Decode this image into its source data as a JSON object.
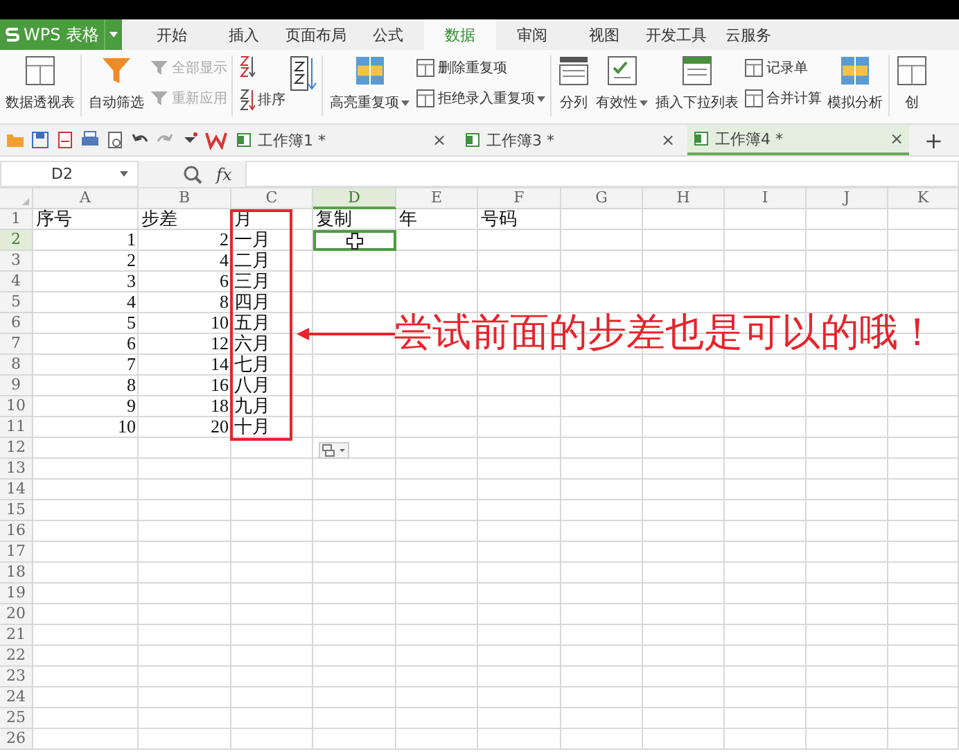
{
  "app": {
    "logo": "WPS 表格"
  },
  "menu_tabs": [
    {
      "label": "开始",
      "selected": false
    },
    {
      "label": "插入",
      "selected": false
    },
    {
      "label": "页面布局",
      "selected": false
    },
    {
      "label": "公式",
      "selected": false
    },
    {
      "label": "数据",
      "selected": true
    },
    {
      "label": "审阅",
      "selected": false
    },
    {
      "label": "视图",
      "selected": false
    },
    {
      "label": "开发工具",
      "selected": false
    },
    {
      "label": "云服务",
      "selected": false
    }
  ],
  "ribbon": {
    "groups": [
      {
        "items": [
          {
            "kind": "large",
            "label": "数据透视表",
            "disabled": false,
            "dropdown": false
          }
        ]
      },
      {
        "items": [
          {
            "kind": "large",
            "label": "自动筛选",
            "disabled": false,
            "dropdown": false
          },
          {
            "kind": "stack",
            "items": [
              {
                "label": "全部显示",
                "disabled": true,
                "dropdown": false
              },
              {
                "label": "重新应用",
                "disabled": true,
                "dropdown": false
              }
            ]
          }
        ]
      },
      {
        "items": [
          {
            "kind": "sort",
            "label": "排序",
            "disabled": false,
            "dropdown": false
          }
        ]
      },
      {
        "items": [
          {
            "kind": "large",
            "label": "高亮重复项",
            "disabled": false,
            "dropdown": true
          },
          {
            "kind": "stack",
            "items": [
              {
                "label": "删除重复项",
                "disabled": false,
                "dropdown": false
              },
              {
                "label": "拒绝录入重复项",
                "disabled": false,
                "dropdown": true
              }
            ]
          }
        ]
      },
      {
        "items": [
          {
            "kind": "large",
            "label": "分列",
            "disabled": false,
            "dropdown": false
          },
          {
            "kind": "large",
            "label": "有效性",
            "disabled": false,
            "dropdown": true
          },
          {
            "kind": "large",
            "label": "插入下拉列表",
            "disabled": false,
            "dropdown": false
          },
          {
            "kind": "stack",
            "items": [
              {
                "label": "记录单",
                "disabled": false,
                "dropdown": false
              },
              {
                "label": "合并计算",
                "disabled": false,
                "dropdown": false
              }
            ]
          },
          {
            "kind": "large",
            "label": "模拟分析",
            "disabled": false,
            "dropdown": false
          }
        ]
      },
      {
        "items": [
          {
            "kind": "large",
            "label": "创",
            "disabled": false,
            "dropdown": false
          }
        ]
      }
    ]
  },
  "doc_tabs": [
    {
      "label": "工作簿1 *",
      "close": "×",
      "selected": false
    },
    {
      "label": "工作簿3 *",
      "close": "×",
      "selected": false
    },
    {
      "label": "工作簿4 *",
      "close": "×",
      "selected": true
    }
  ],
  "new_tab": "+",
  "formula_bar": {
    "name_box": "D2",
    "fx": "fx"
  },
  "sheet": {
    "columns": [
      "A",
      "B",
      "C",
      "D",
      "E",
      "F",
      "G",
      "H",
      "I",
      "J",
      "K"
    ],
    "rows": [
      {
        "number": "1",
        "cells": [
          {
            "text": "序号",
            "kind": "text",
            "selected": false
          },
          {
            "text": "步差",
            "kind": "text",
            "selected": false
          },
          {
            "text": "月",
            "kind": "text",
            "selected": false
          },
          {
            "text": "复制",
            "kind": "text",
            "selected": false
          },
          {
            "text": "年",
            "kind": "text",
            "selected": false
          },
          {
            "text": "号码",
            "kind": "text",
            "selected": false
          }
        ]
      },
      {
        "number": "2",
        "cells": [
          {
            "text": "1",
            "kind": "number",
            "selected": false
          },
          {
            "text": "2",
            "kind": "number",
            "selected": false
          },
          {
            "text": "一月",
            "kind": "text",
            "selected": false
          },
          {
            "kind": "text",
            "selected": true
          }
        ]
      },
      {
        "number": "3",
        "cells": [
          {
            "text": "2",
            "kind": "number",
            "selected": false
          },
          {
            "text": "4",
            "kind": "number",
            "selected": false
          },
          {
            "text": "二月",
            "kind": "text",
            "selected": false
          }
        ]
      },
      {
        "number": "4",
        "cells": [
          {
            "text": "3",
            "kind": "number",
            "selected": false
          },
          {
            "text": "6",
            "kind": "number",
            "selected": false
          },
          {
            "text": "三月",
            "kind": "text",
            "selected": false
          }
        ]
      },
      {
        "number": "5",
        "cells": [
          {
            "text": "4",
            "kind": "number",
            "selected": false
          },
          {
            "text": "8",
            "kind": "number",
            "selected": false
          },
          {
            "text": "四月",
            "kind": "text",
            "selected": false
          }
        ]
      },
      {
        "number": "6",
        "cells": [
          {
            "text": "5",
            "kind": "number",
            "selected": false
          },
          {
            "text": "10",
            "kind": "number",
            "selected": false
          },
          {
            "text": "五月",
            "kind": "text",
            "selected": false
          }
        ]
      },
      {
        "number": "7",
        "cells": [
          {
            "text": "6",
            "kind": "number",
            "selected": false
          },
          {
            "text": "12",
            "kind": "number",
            "selected": false
          },
          {
            "text": "六月",
            "kind": "text",
            "selected": false
          }
        ]
      },
      {
        "number": "8",
        "cells": [
          {
            "text": "7",
            "kind": "number",
            "selected": false
          },
          {
            "text": "14",
            "kind": "number",
            "selected": false
          },
          {
            "text": "七月",
            "kind": "text",
            "selected": false
          }
        ]
      },
      {
        "number": "9",
        "cells": [
          {
            "text": "8",
            "kind": "number",
            "selected": false
          },
          {
            "text": "16",
            "kind": "number",
            "selected": false
          },
          {
            "text": "八月",
            "kind": "text",
            "selected": false
          }
        ]
      },
      {
        "number": "10",
        "cells": [
          {
            "text": "9",
            "kind": "number",
            "selected": false
          },
          {
            "text": "18",
            "kind": "number",
            "selected": false
          },
          {
            "text": "九月",
            "kind": "text",
            "selected": false
          }
        ]
      },
      {
        "number": "11",
        "cells": [
          {
            "text": "10",
            "kind": "number",
            "selected": false
          },
          {
            "text": "20",
            "kind": "number",
            "selected": false
          },
          {
            "text": "十月",
            "kind": "text",
            "selected": false
          }
        ]
      },
      {
        "number": "12",
        "cells": []
      },
      {
        "number": "13",
        "cells": []
      },
      {
        "number": "14",
        "cells": []
      },
      {
        "number": "15",
        "cells": []
      },
      {
        "number": "16",
        "cells": []
      },
      {
        "number": "17",
        "cells": []
      },
      {
        "number": "18",
        "cells": []
      },
      {
        "number": "19",
        "cells": []
      },
      {
        "number": "20",
        "cells": []
      },
      {
        "number": "21",
        "cells": []
      },
      {
        "number": "22",
        "cells": []
      },
      {
        "number": "23",
        "cells": []
      },
      {
        "number": "24",
        "cells": []
      },
      {
        "number": "25",
        "cells": []
      },
      {
        "number": "26",
        "cells": []
      }
    ]
  },
  "annotation": {
    "text": "尝试前面的步差也是可以的哦！"
  }
}
